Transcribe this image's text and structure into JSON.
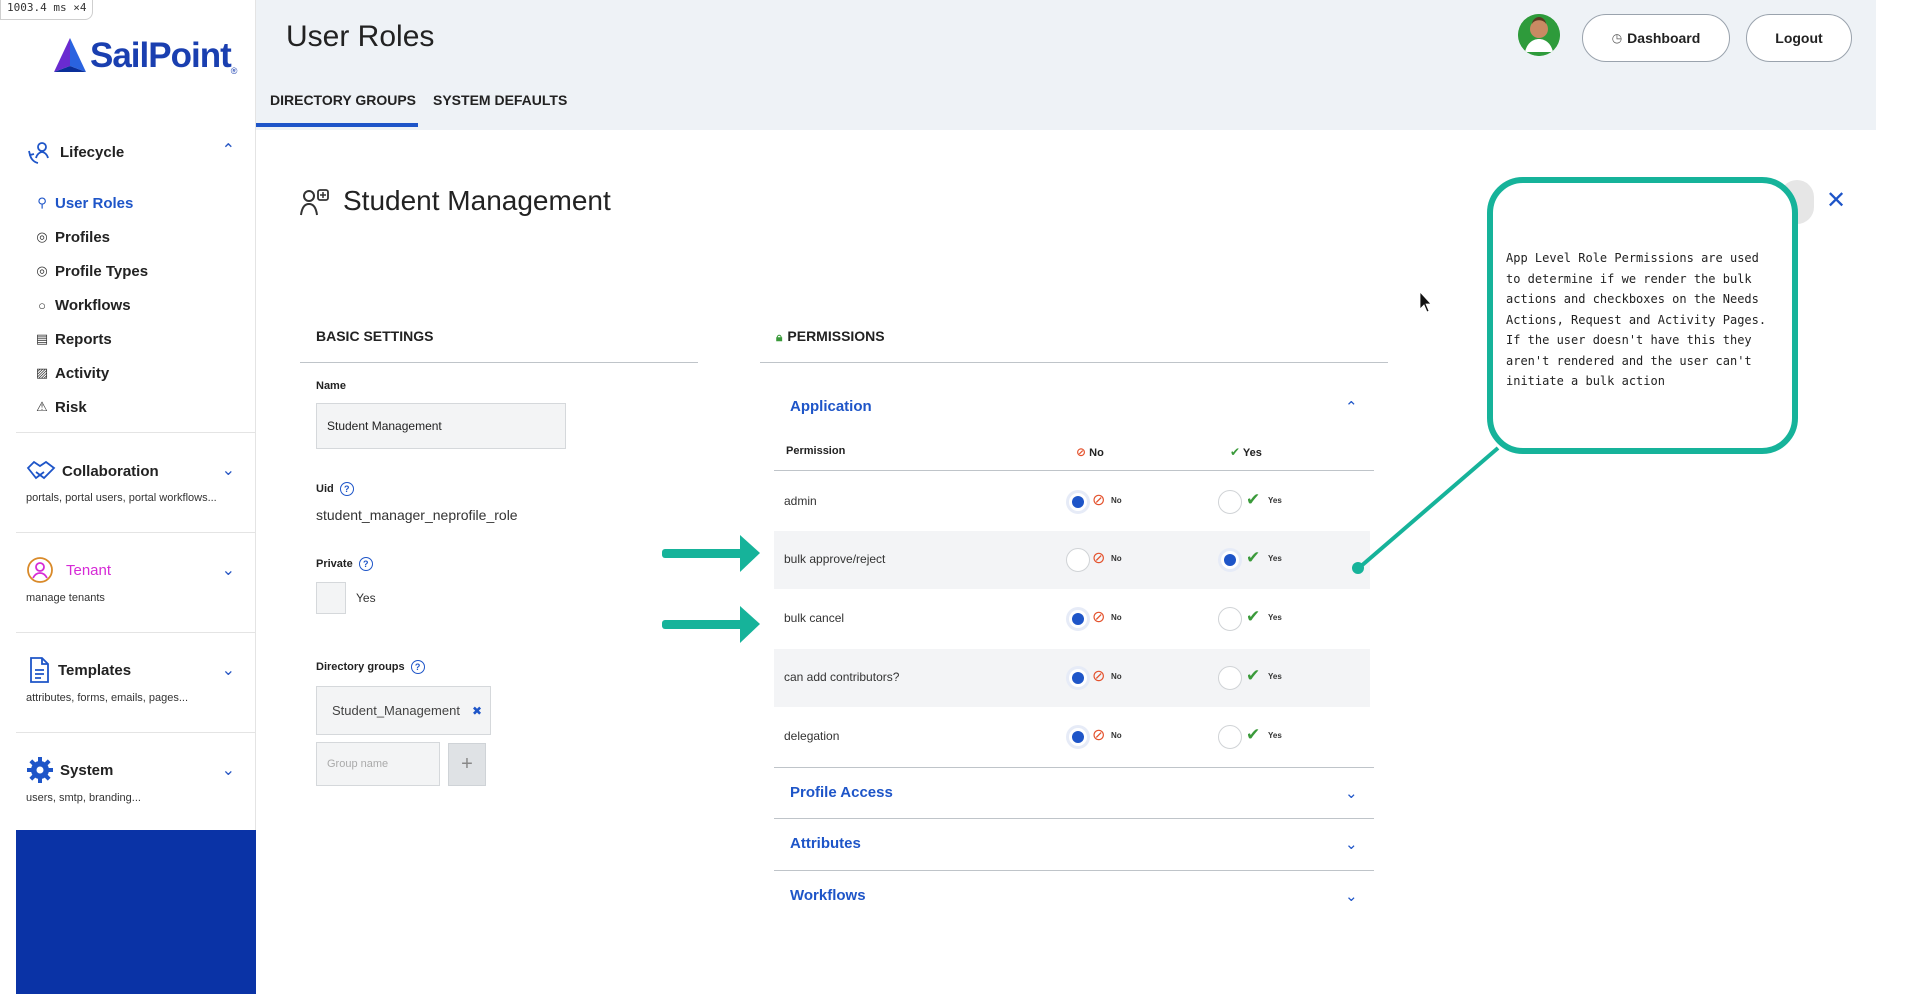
{
  "debug": {
    "text": "1003.4 ms ×4"
  },
  "sidebar": {
    "logo": "SailPoint",
    "logo_mark": "®",
    "lifecycle": {
      "label": "Lifecycle",
      "items": [
        {
          "label": "User Roles",
          "icon": "user-roles-icon"
        },
        {
          "label": "Profiles",
          "icon": "profiles-icon"
        },
        {
          "label": "Profile Types",
          "icon": "profile-types-icon"
        },
        {
          "label": "Workflows",
          "icon": "workflows-icon"
        },
        {
          "label": "Reports",
          "icon": "reports-icon"
        },
        {
          "label": "Activity",
          "icon": "activity-icon"
        },
        {
          "label": "Risk",
          "icon": "risk-icon"
        }
      ]
    },
    "collaboration": {
      "label": "Collaboration",
      "sub": "portals, portal users, portal workflows..."
    },
    "tenant": {
      "label": "Tenant",
      "sub": "manage tenants"
    },
    "templates": {
      "label": "Templates",
      "sub": "attributes, forms, emails, pages..."
    },
    "system": {
      "label": "System",
      "sub": "users, smtp, branding..."
    }
  },
  "header": {
    "title": "User Roles",
    "tabs": [
      "DIRECTORY GROUPS",
      "SYSTEM DEFAULTS"
    ],
    "dashboard_label": "Dashboard",
    "logout_label": "Logout"
  },
  "role": {
    "title": "Student Management",
    "basic_settings": {
      "heading": "BASIC SETTINGS",
      "name_label": "Name",
      "name_value": "Student Management",
      "uid_label": "Uid",
      "uid_value": "student_manager_neprofile_role",
      "private_label": "Private",
      "private_option": "Yes",
      "directory_groups_label": "Directory groups",
      "group_chip": "Student_Management",
      "group_placeholder": "Group name"
    },
    "permissions": {
      "heading": "PERMISSIONS",
      "application_label": "Application",
      "col_permission": "Permission",
      "col_no": "No",
      "col_yes": "Yes",
      "rows": [
        {
          "label": "admin",
          "value": "No"
        },
        {
          "label": "bulk approve/reject",
          "value": "Yes"
        },
        {
          "label": "bulk cancel",
          "value": "No"
        },
        {
          "label": "can add contributors?",
          "value": "No"
        },
        {
          "label": "delegation",
          "value": "No"
        }
      ],
      "collapsed_sections": [
        "Profile Access",
        "Attributes",
        "Workflows"
      ]
    }
  },
  "annotation": {
    "callout_text": "App Level Role Permissions are used to determine if we render the bulk actions and checkboxes on the Needs Actions, Request and Activity Pages. If the user doesn't have this they aren't rendered and the user can't initiate a bulk action",
    "accent_color": "#16b39a"
  },
  "colors": {
    "brand_blue": "#1e55c8",
    "sidebar_footer": "#0a33a6",
    "tenant_pink": "#d62ad6",
    "no_red": "#e4532e",
    "yes_green": "#3a9a3a"
  }
}
